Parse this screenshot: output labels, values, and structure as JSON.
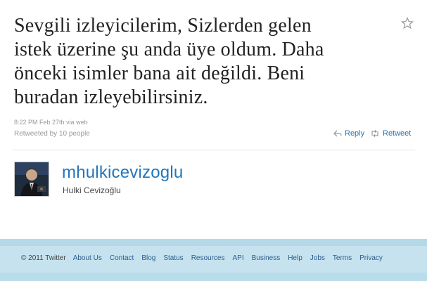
{
  "tweet": {
    "lines": [
      "Sevgili izleyicilerim, Sizlerden gelen",
      "istek üzerine şu anda üye oldum. Daha",
      "önceki isimler bana ait değildi. Beni",
      "buradan izleyebilirsiniz."
    ],
    "timestamp": "8:22 PM Feb 27th",
    "via": "via web",
    "retweeted_by": "Retweeted by 10 people",
    "reply_label": "Reply",
    "retweet_label": "Retweet"
  },
  "author": {
    "username": "mhulkicevizoglu",
    "full_name": "Hulki Cevizoğlu"
  },
  "footer": {
    "copyright": "© 2011 Twitter",
    "links": [
      "About Us",
      "Contact",
      "Blog",
      "Status",
      "Resources",
      "API",
      "Business",
      "Help",
      "Jobs",
      "Terms",
      "Privacy"
    ]
  },
  "colors": {
    "link": "#2276bb",
    "footer_band": "#c6e2ee",
    "footer_link": "#2a5d8c"
  },
  "icons": [
    "star-icon",
    "reply-icon",
    "retweet-icon"
  ]
}
